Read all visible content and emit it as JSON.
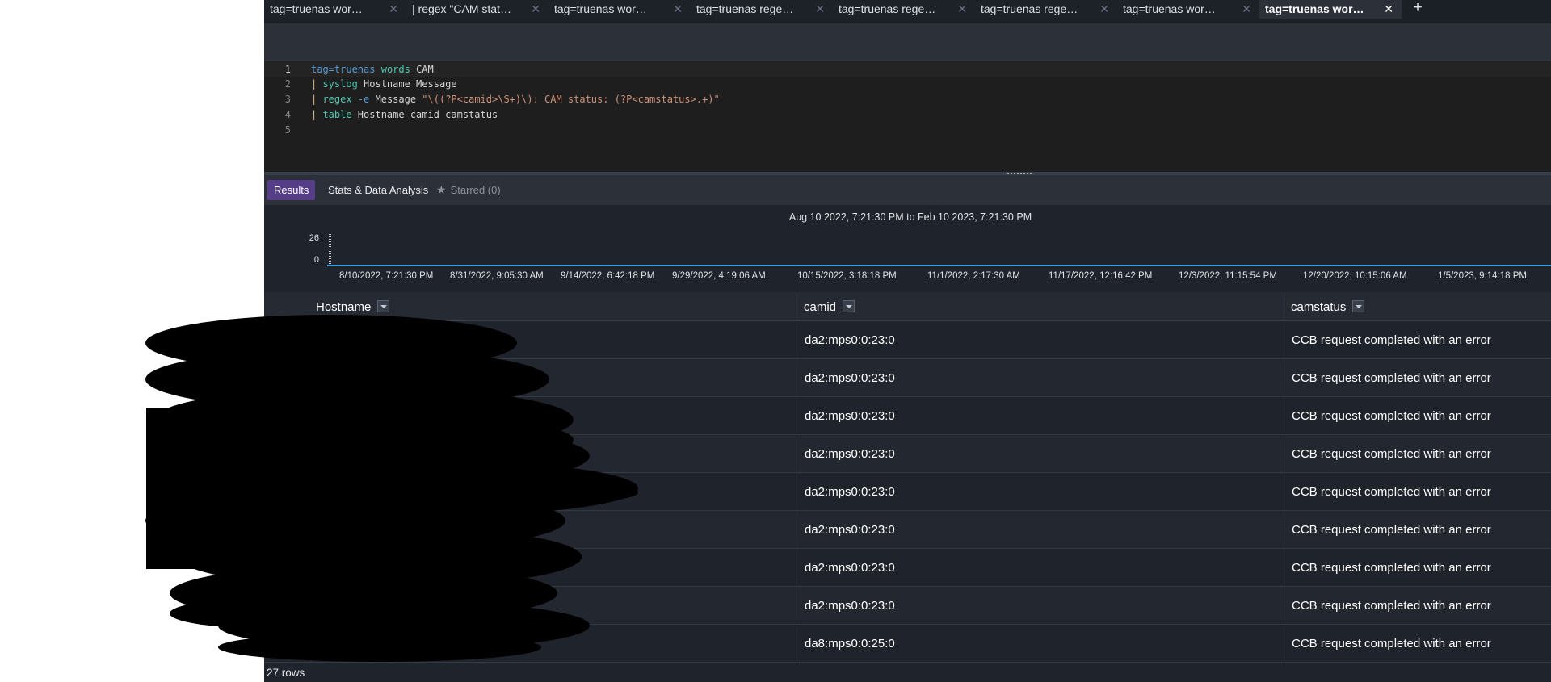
{
  "tabs": [
    {
      "label": "tag=truenas wor…",
      "active": false
    },
    {
      "label": "| regex \"CAM stat…",
      "active": false
    },
    {
      "label": "tag=truenas wor…",
      "active": false
    },
    {
      "label": "tag=truenas rege…",
      "active": false
    },
    {
      "label": "tag=truenas rege…",
      "active": false
    },
    {
      "label": "tag=truenas rege…",
      "active": false
    },
    {
      "label": "tag=truenas wor…",
      "active": false
    },
    {
      "label": "tag=truenas wor…",
      "active": true
    }
  ],
  "tab_close_glyph": "✕",
  "tab_add_glyph": "+",
  "editor": {
    "line_numbers": [
      "1",
      "2",
      "3",
      "4",
      "5"
    ],
    "lines": [
      [
        "",
        "tag=",
        "truenas",
        " ",
        "words",
        " CAM"
      ],
      [
        "| ",
        "syslog",
        " Hostname Message"
      ],
      [
        "| ",
        "regex",
        " -e",
        " Message ",
        "\"\\((?P<camid>\\S+)\\): CAM status: (?P<camstatus>.+)\""
      ],
      [
        "| ",
        "table",
        " Hostname camid camstatus"
      ],
      []
    ]
  },
  "results_tabs": {
    "results": "Results",
    "stats": "Stats & Data Analysis",
    "starred": "Starred (0)"
  },
  "histogram": {
    "range": "Aug 10 2022, 7:21:30 PM to Feb 10 2023, 7:21:30 PM",
    "y_max": "26",
    "y_min": "0",
    "x_ticks": [
      "8/10/2022, 7:21:30 PM",
      "8/31/2022, 9:05:30 AM",
      "9/14/2022, 6:42:18 PM",
      "9/29/2022, 4:19:06 AM",
      "10/15/2022, 3:18:18 PM",
      "11/1/2022, 2:17:30 AM",
      "11/17/2022, 12:16:42 PM",
      "12/3/2022, 11:15:54 PM",
      "12/20/2022, 10:15:06 AM",
      "1/5/2023, 9:14:18 PM"
    ]
  },
  "table": {
    "columns": [
      "Hostname",
      "camid",
      "camstatus"
    ],
    "rows": [
      {
        "hostname": "",
        "camid": "da2:mps0:0:23:0",
        "camstatus": "CCB request completed with an error"
      },
      {
        "hostname": "",
        "camid": "da2:mps0:0:23:0",
        "camstatus": "CCB request completed with an error"
      },
      {
        "hostname": "",
        "camid": "da2:mps0:0:23:0",
        "camstatus": "CCB request completed with an error"
      },
      {
        "hostname": "",
        "camid": "da2:mps0:0:23:0",
        "camstatus": "CCB request completed with an error"
      },
      {
        "hostname": "",
        "camid": "da2:mps0:0:23:0",
        "camstatus": "CCB request completed with an error"
      },
      {
        "hostname": "",
        "camid": "da2:mps0:0:23:0",
        "camstatus": "CCB request completed with an error"
      },
      {
        "hostname": "",
        "camid": "da2:mps0:0:23:0",
        "camstatus": "CCB request completed with an error"
      },
      {
        "hostname": "",
        "camid": "da2:mps0:0:23:0",
        "camstatus": "CCB request completed with an error"
      },
      {
        "hostname": "",
        "camid": "da8:mps0:0:25:0",
        "camstatus": "CCB request completed with an error"
      }
    ],
    "row_count": "27 rows"
  },
  "colors": {
    "accent": "#553d87",
    "timeline": "#3b9ad9",
    "background": "#1f232b"
  }
}
